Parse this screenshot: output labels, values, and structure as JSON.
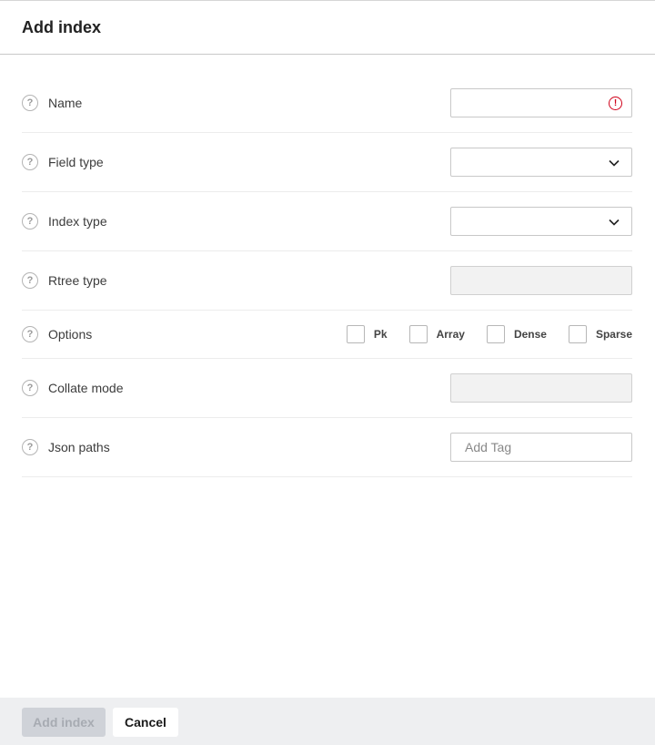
{
  "dialog": {
    "title": "Add index"
  },
  "fields": {
    "name": {
      "label": "Name",
      "value": "",
      "placeholder": ""
    },
    "field_type": {
      "label": "Field type",
      "value": ""
    },
    "index_type": {
      "label": "Index type",
      "value": ""
    },
    "rtree_type": {
      "label": "Rtree type",
      "value": ""
    },
    "options": {
      "label": "Options",
      "items": [
        {
          "label": "Pk",
          "checked": false
        },
        {
          "label": "Array",
          "checked": false
        },
        {
          "label": "Dense",
          "checked": false
        },
        {
          "label": "Sparse",
          "checked": false
        }
      ]
    },
    "collate_mode": {
      "label": "Collate mode",
      "value": ""
    },
    "json_paths": {
      "label": "Json paths",
      "placeholder": "Add Tag"
    }
  },
  "footer": {
    "submit_label": "Add index",
    "cancel_label": "Cancel"
  },
  "colors": {
    "error": "#d0021b",
    "footer_bg": "#eeeff1",
    "disabled_button": "#cfd2d8"
  },
  "icons": {
    "help": "question-circle-icon",
    "error": "exclamation-circle-icon",
    "dropdown": "chevron-down-icon"
  }
}
